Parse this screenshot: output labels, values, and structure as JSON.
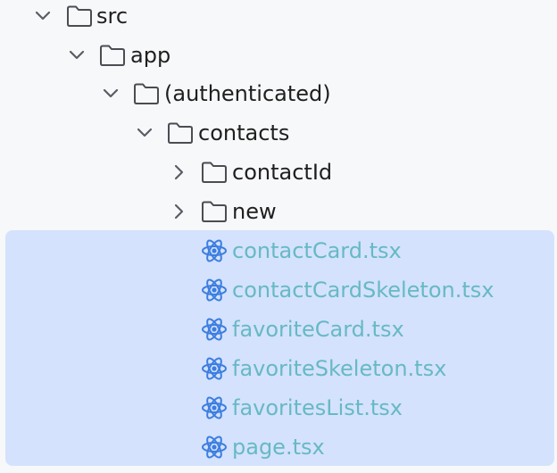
{
  "tree": {
    "folders": [
      {
        "label": "src",
        "expanded": true
      },
      {
        "label": "app",
        "expanded": true
      },
      {
        "label": "(authenticated)",
        "expanded": true
      },
      {
        "label": "contacts",
        "expanded": true
      },
      {
        "label": "contactId",
        "expanded": false
      },
      {
        "label": "new",
        "expanded": false
      }
    ],
    "files": [
      {
        "label": "contactCard.tsx",
        "icon": "react-icon"
      },
      {
        "label": "contactCardSkeleton.tsx",
        "icon": "react-icon"
      },
      {
        "label": "favoriteCard.tsx",
        "icon": "react-icon"
      },
      {
        "label": "favoriteSkeleton.tsx",
        "icon": "react-icon"
      },
      {
        "label": "favoritesList.tsx",
        "icon": "react-icon"
      },
      {
        "label": "page.tsx",
        "icon": "react-icon"
      }
    ]
  },
  "colors": {
    "background": "#f7f8fa",
    "selection": "#d4e2fd",
    "folder_text": "#1f1f1f",
    "file_text": "#67b9c4",
    "react_icon": "#3b7de0"
  }
}
